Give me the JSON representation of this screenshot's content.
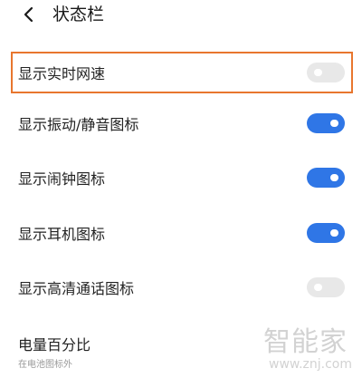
{
  "header": {
    "title": "状态栏",
    "back_icon": "chevron-left-icon"
  },
  "settings": [
    {
      "label": "显示实时网速",
      "enabled": false,
      "highlighted": true
    },
    {
      "label": "显示振动/静音图标",
      "enabled": true,
      "highlighted": false
    },
    {
      "label": "显示闹钟图标",
      "enabled": true,
      "highlighted": false
    },
    {
      "label": "显示耳机图标",
      "enabled": true,
      "highlighted": false
    },
    {
      "label": "显示高清通话图标",
      "enabled": false,
      "highlighted": false
    }
  ],
  "battery": {
    "label": "电量百分比",
    "value": "在电池图标外"
  },
  "watermark": {
    "text": "智能家",
    "url": "www.znj.com"
  },
  "colors": {
    "toggle_on": "#2f76e6",
    "toggle_off": "#e8e8e8",
    "highlight": "#e8762e"
  }
}
